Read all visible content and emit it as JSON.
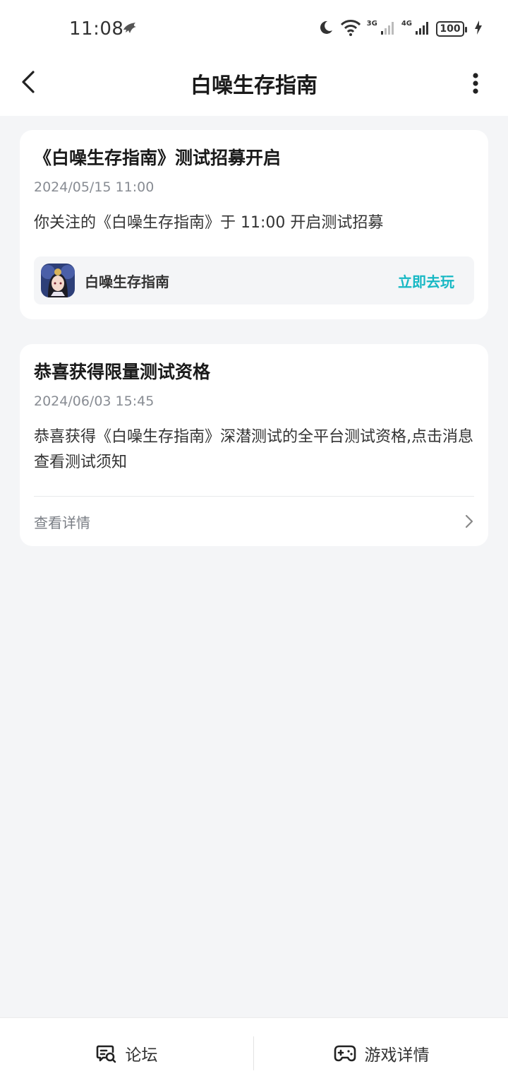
{
  "status_bar": {
    "time": "11:08",
    "net_3g": "3G",
    "net_4g": "4G",
    "battery": "100"
  },
  "header": {
    "title": "白噪生存指南"
  },
  "messages": [
    {
      "title": "《白噪生存指南》测试招募开启",
      "time": "2024/05/15 11:00",
      "body": "你关注的《白噪生存指南》于 11:00 开启测试招募",
      "game_name": "白噪生存指南",
      "action_label": "立即去玩"
    },
    {
      "title": "恭喜获得限量测试资格",
      "time": "2024/06/03 15:45",
      "body": "恭喜获得《白噪生存指南》深潜测试的全平台测试资格,点击消息查看测试须知",
      "detail_label": "查看详情"
    }
  ],
  "bottom_bar": {
    "forum_label": "论坛",
    "game_detail_label": "游戏详情"
  },
  "colors": {
    "accent": "#17b8c4",
    "background": "#f4f5f7"
  }
}
